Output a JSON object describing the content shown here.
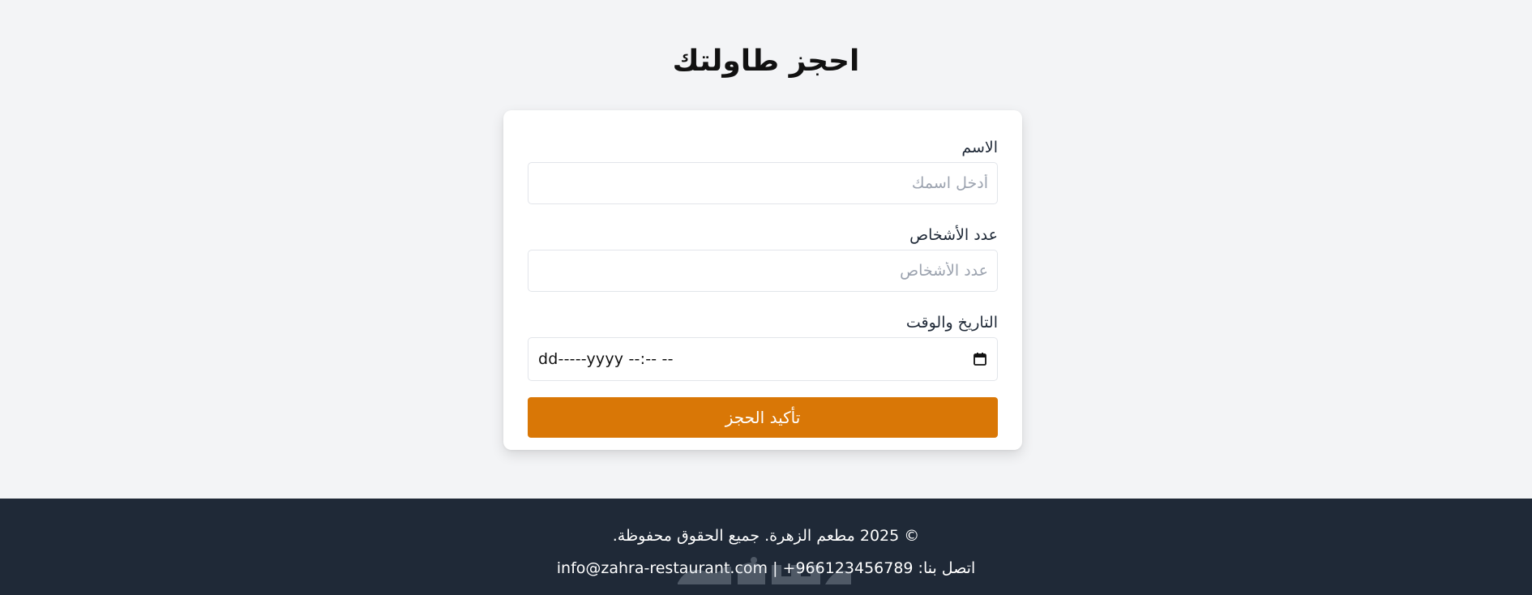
{
  "page": {
    "title": "احجز طاولتك"
  },
  "form": {
    "name": {
      "label": "الاسم",
      "placeholder": "أدخل اسمك",
      "value": ""
    },
    "guests": {
      "label": "عدد الأشخاص",
      "placeholder": "عدد الأشخاص",
      "value": ""
    },
    "datetime": {
      "label": "التاريخ والوقت",
      "display": "dd-----yyyy --:-- --",
      "icon": "calendar-icon"
    },
    "submit_label": "تأكيد الحجز"
  },
  "footer": {
    "copyright": "© 2025 مطعم الزهرة. جميع الحقوق محفوظة.",
    "contact": "اتصل بنا: 966123456789+ | info@zahra-restaurant.com"
  },
  "colors": {
    "background": "#f3f4f6",
    "card": "#ffffff",
    "accent": "#d97706",
    "footer": "#1f2937"
  }
}
